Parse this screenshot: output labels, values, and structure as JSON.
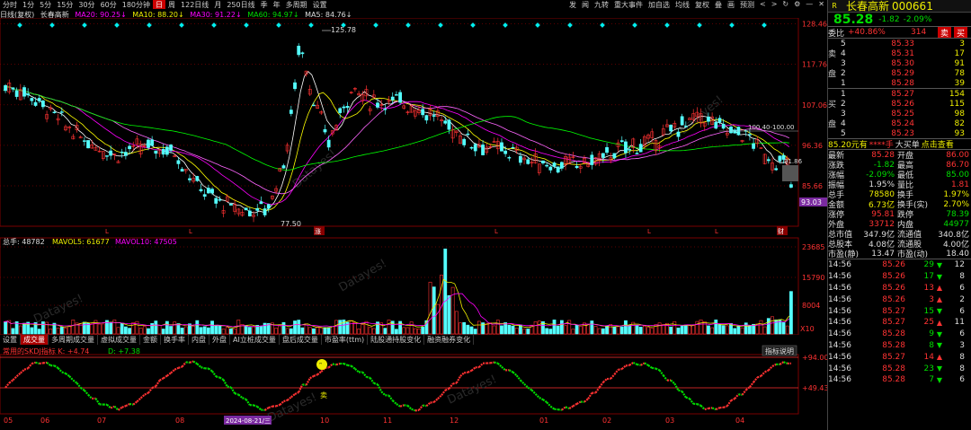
{
  "colors": {
    "up": "#ff3232",
    "down": "#54ffff",
    "ma5": "#ffffff",
    "ma10": "#ffff00",
    "ma20": "#ff00ff",
    "ma30": "#00ff00",
    "ma60": "#c0c0c0",
    "grid": "#7a0000"
  },
  "toolbar": {
    "periods": [
      "分时",
      "1分",
      "5分",
      "15分",
      "30分",
      "60分",
      "180分钟",
      "日",
      "周",
      "122日线",
      "月",
      "250日线",
      "季",
      "年",
      "多周期",
      "设置"
    ],
    "active_period": "日",
    "right_items": [
      "发",
      "闻",
      "九转",
      "重大事件",
      "加自选",
      "均线",
      "复权",
      "叠",
      "画",
      "预测",
      "<",
      ">"
    ],
    "icon_names": [
      "refresh-icon",
      "settings-icon",
      "minimize-icon",
      "close-icon"
    ]
  },
  "ma_bar": {
    "name": "长春高新",
    "ma20": "MA20: 90.25↓",
    "ma10": "MA10: 88.20↓",
    "ma30": "MA30: 91.22↓",
    "ma60": "MA60: 94.97↓",
    "ma5": "MA5: 84.76↓"
  },
  "price_panel": {
    "title": "日线(复权)",
    "yaxis": [
      "128.46",
      "117.76",
      "107.06",
      "96.36",
      "85.66"
    ],
    "hi_label": "125.78",
    "lo_label": "77.50",
    "target_label": "100.40-100.00",
    "last_label": "91.86",
    "current": "93.03",
    "watermark": "Datayes!",
    "flag_chars": [
      "涨",
      "财"
    ]
  },
  "vol_panel": {
    "label_total": "总手: 48782",
    "label_ma5": "MAVOL5: 61677",
    "label_ma10": "MAVOL10: 47505",
    "yaxis": [
      "23685",
      "15790",
      "8004",
      "X10"
    ]
  },
  "tabs": [
    "设置",
    "成交量",
    "多周期成交量",
    "虚拟成交量",
    "金额",
    "换手率",
    "内盘",
    "外盘",
    "AI立桩成交量",
    "盘后成交量",
    "市盈率(ttm)",
    "陆股通持股变化",
    "融资融券变化"
  ],
  "active_tab": "成交量",
  "kdj": {
    "label": "常用的SKDJ指标 K: +4.74",
    "d_label": "D: +7.38",
    "help_button": "指标说明",
    "yaxis": [
      "+94.00",
      "+49.43"
    ],
    "flag_char": "卖"
  },
  "xaxis": {
    "months": [
      "05",
      "06",
      "07",
      "08",
      "09",
      "10",
      "11",
      "12",
      "01",
      "02",
      "03",
      "04"
    ],
    "selected_date": "2024-08-21/三"
  },
  "quote": {
    "flag": "R",
    "name": "长春高新",
    "code": "000661",
    "price": "85.28",
    "change": "-1.82",
    "pct": "-2.09%",
    "weibi_label": "委比",
    "weibi": "+40.86%",
    "weicha": "314",
    "sell_btn": "卖",
    "buy_btn": "买",
    "asks": [
      {
        "n": "5",
        "p": "85.33",
        "v": "3"
      },
      {
        "n": "4",
        "p": "85.31",
        "v": "17"
      },
      {
        "n": "3",
        "p": "85.30",
        "v": "91"
      },
      {
        "n": "2",
        "p": "85.29",
        "v": "78"
      },
      {
        "n": "1",
        "p": "85.28",
        "v": "39"
      }
    ],
    "ask_side": "卖盘",
    "bid_side": "买盘",
    "bids": [
      {
        "n": "1",
        "p": "85.27",
        "v": "154"
      },
      {
        "n": "2",
        "p": "85.26",
        "v": "115"
      },
      {
        "n": "3",
        "p": "85.25",
        "v": "98"
      },
      {
        "n": "4",
        "p": "85.24",
        "v": "82"
      },
      {
        "n": "5",
        "p": "85.23",
        "v": "93"
      }
    ],
    "bigbuy": {
      "price": "85.20元有",
      "stars": "****手",
      "text": "大买单",
      "link": "点击查看"
    },
    "stats": [
      {
        "k1": "最新",
        "v1": "85.28",
        "c1": "red",
        "k2": "开盘",
        "v2": "86.00",
        "c2": "red"
      },
      {
        "k1": "涨跌",
        "v1": "-1.82",
        "c1": "grn",
        "k2": "最高",
        "v2": "86.70",
        "c2": "red"
      },
      {
        "k1": "涨幅",
        "v1": "-2.09%",
        "c1": "grn",
        "k2": "最低",
        "v2": "85.00",
        "c2": "grn"
      },
      {
        "k1": "振幅",
        "v1": "1.95%",
        "c1": "wh",
        "k2": "量比",
        "v2": "1.81",
        "c2": "red"
      },
      {
        "k1": "总手",
        "v1": "78580",
        "c1": "yel",
        "k2": "换手",
        "v2": "1.97%",
        "c2": "yel"
      },
      {
        "k1": "金额",
        "v1": "6.73亿",
        "c1": "yel",
        "k2": "换手(实)",
        "v2": "2.70%",
        "c2": "yel"
      },
      {
        "k1": "涨停",
        "v1": "95.81",
        "c1": "red",
        "k2": "跌停",
        "v2": "78.39",
        "c2": "grn"
      },
      {
        "k1": "外盘",
        "v1": "33712",
        "c1": "red",
        "k2": "内盘",
        "v2": "44977",
        "c2": "grn"
      },
      {
        "k1": "总市值",
        "v1": "347.9亿",
        "c1": "wh",
        "k2": "流通值",
        "v2": "340.8亿",
        "c2": "wh"
      },
      {
        "k1": "总股本",
        "v1": "4.08亿",
        "c1": "wh",
        "k2": "流通股",
        "v2": "4.00亿",
        "c2": "wh"
      },
      {
        "k1": "市盈(静)",
        "v1": "13.47",
        "c1": "wh",
        "k2": "市盈(动)",
        "v2": "18.40",
        "c2": "wh"
      }
    ],
    "ticks": [
      {
        "t": "14:56",
        "p": "85.26",
        "v": "29",
        "d": "down",
        "n": "12"
      },
      {
        "t": "14:56",
        "p": "85.26",
        "v": "17",
        "d": "down",
        "n": "8"
      },
      {
        "t": "14:56",
        "p": "85.26",
        "v": "13",
        "d": "up",
        "n": "6"
      },
      {
        "t": "14:56",
        "p": "85.26",
        "v": "3",
        "d": "up",
        "n": "2"
      },
      {
        "t": "14:56",
        "p": "85.27",
        "v": "15",
        "d": "down",
        "n": "6"
      },
      {
        "t": "14:56",
        "p": "85.27",
        "v": "25",
        "d": "up",
        "n": "11"
      },
      {
        "t": "14:56",
        "p": "85.28",
        "v": "9",
        "d": "down",
        "n": "6"
      },
      {
        "t": "14:56",
        "p": "85.28",
        "v": "8",
        "d": "down",
        "n": "3"
      },
      {
        "t": "14:56",
        "p": "85.27",
        "v": "14",
        "d": "up",
        "n": "8"
      },
      {
        "t": "14:56",
        "p": "85.28",
        "v": "23",
        "d": "down",
        "n": "8"
      },
      {
        "t": "14:56",
        "p": "85.28",
        "v": "7",
        "d": "down",
        "n": "6"
      }
    ]
  }
}
